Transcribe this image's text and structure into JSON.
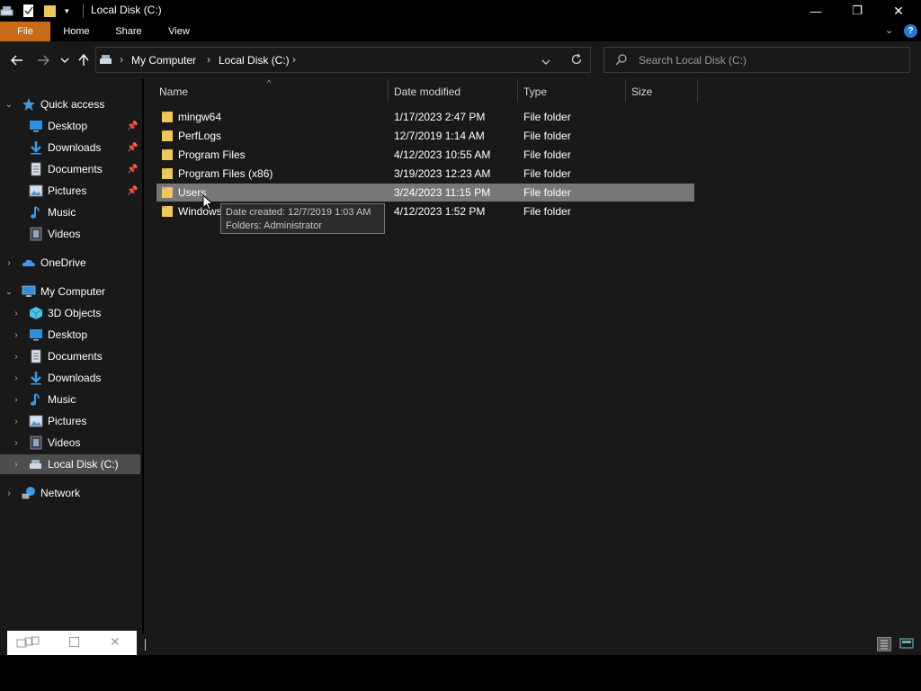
{
  "window": {
    "title": "Local Disk (C:)",
    "controls": {
      "minimize": "—",
      "restore": "❐",
      "close": "✕"
    }
  },
  "ribbon": {
    "tabs": [
      "File",
      "Home",
      "Share",
      "View"
    ],
    "help_icon": "?"
  },
  "address": {
    "segments": [
      "My Computer",
      "Local Disk (C:)"
    ],
    "separator": "›"
  },
  "search": {
    "placeholder": "Search Local Disk (C:)"
  },
  "navpane": {
    "quick_access": {
      "label": "Quick access",
      "items": [
        {
          "label": "Desktop",
          "icon": "desktop-icon",
          "pinned": true
        },
        {
          "label": "Downloads",
          "icon": "downloads-icon",
          "pinned": true
        },
        {
          "label": "Documents",
          "icon": "documents-icon",
          "pinned": true
        },
        {
          "label": "Pictures",
          "icon": "pictures-icon",
          "pinned": true
        },
        {
          "label": "Music",
          "icon": "music-icon",
          "pinned": false
        },
        {
          "label": "Videos",
          "icon": "videos-icon",
          "pinned": false
        }
      ]
    },
    "onedrive": {
      "label": "OneDrive"
    },
    "my_computer": {
      "label": "My Computer",
      "items": [
        {
          "label": "3D Objects",
          "icon": "3d-objects-icon"
        },
        {
          "label": "Desktop",
          "icon": "desktop-icon"
        },
        {
          "label": "Documents",
          "icon": "documents-icon"
        },
        {
          "label": "Downloads",
          "icon": "downloads-icon"
        },
        {
          "label": "Music",
          "icon": "music-icon"
        },
        {
          "label": "Pictures",
          "icon": "pictures-icon"
        },
        {
          "label": "Videos",
          "icon": "videos-icon"
        },
        {
          "label": "Local Disk (C:)",
          "icon": "drive-icon",
          "selected": true
        }
      ]
    },
    "network": {
      "label": "Network"
    }
  },
  "columns": {
    "name": "Name",
    "date": "Date modified",
    "type": "Type",
    "size": "Size"
  },
  "files": [
    {
      "name": "mingw64",
      "date": "1/17/2023 2:47 PM",
      "type": "File folder",
      "selected": false
    },
    {
      "name": "PerfLogs",
      "date": "12/7/2019 1:14 AM",
      "type": "File folder",
      "selected": false
    },
    {
      "name": "Program Files",
      "date": "4/12/2023 10:55 AM",
      "type": "File folder",
      "selected": false
    },
    {
      "name": "Program Files (x86)",
      "date": "3/19/2023 12:23 AM",
      "type": "File folder",
      "selected": false
    },
    {
      "name": "Users",
      "date": "3/24/2023 11:15 PM",
      "type": "File folder",
      "selected": true
    },
    {
      "name": "Windows",
      "date": "4/12/2023 1:52 PM",
      "type": "File folder",
      "selected": false
    }
  ],
  "tooltip": {
    "line1": "Date created: 12/7/2019 1:03 AM",
    "line2": "Folders: Administrator"
  },
  "colors": {
    "file_tab": "#c86a1a",
    "folder": "#f0c75e",
    "selection": "#777777",
    "pane_bg": "#191919"
  }
}
